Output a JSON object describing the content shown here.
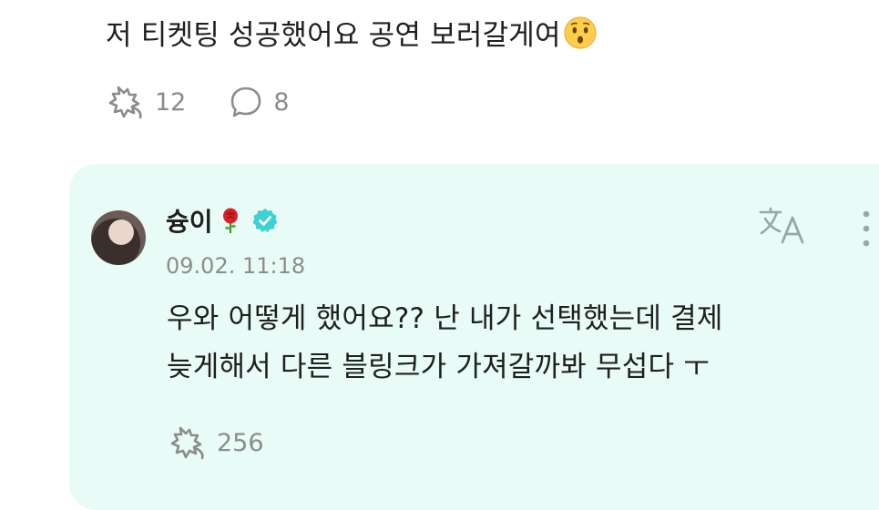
{
  "post": {
    "text": "저 티켓팅 성공했어요 공연 보러갈게여",
    "emoji_icon": "hushed-face-emoji",
    "like_count": "12",
    "comment_count": "8"
  },
  "reply": {
    "author_name": "슝이",
    "author_emoji_icon": "rose-emoji",
    "verified_icon": "verified-badge-icon",
    "timestamp": "09.02. 11:18",
    "text_line1": "우와 어떻게 했어요?? 난 내가 선택했는데 결제",
    "text_line2": "늦게해서 다른 블링크가 가져갈까봐 무섭다 ㅜ",
    "like_count": "256",
    "translate_icon": "translate-icon",
    "more_icon": "more-vertical-icon"
  },
  "colors": {
    "card_background": "#e8fbf6",
    "verified": "#3fd0d4",
    "muted": "#8c8c8c"
  }
}
